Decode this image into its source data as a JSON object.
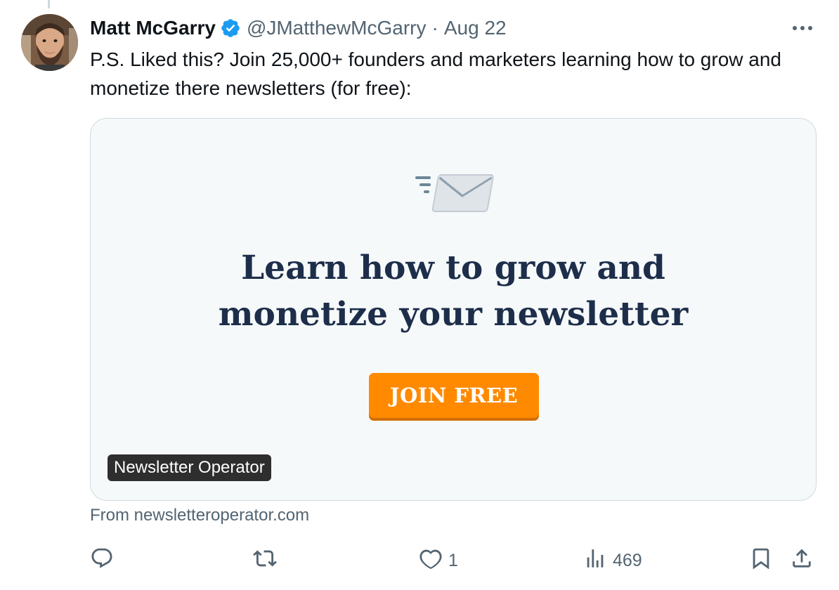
{
  "tweet": {
    "display_name": "Matt McGarry",
    "handle": "@JMatthewMcGarry",
    "separator": "·",
    "date": "Aug 22",
    "text": "P.S. Liked this? Join 25,000+ founders and marketers learning how to grow and monetize there newsletters (for free):"
  },
  "card": {
    "headline_line1": "Learn how to grow and",
    "headline_line2": "monetize your newsletter",
    "button_label": "JOIN FREE",
    "site_badge": "Newsletter Operator",
    "source": "From newsletteroperator.com"
  },
  "actions": {
    "reply_count": "",
    "retweet_count": "",
    "like_count": "1",
    "views_count": "469"
  },
  "icons": {
    "verified": "verified-badge-icon",
    "more": "more-icon",
    "mail": "envelope-icon",
    "reply": "reply-icon",
    "retweet": "retweet-icon",
    "like": "heart-icon",
    "views": "views-icon",
    "bookmark": "bookmark-icon",
    "share": "share-icon"
  },
  "colors": {
    "verified_blue": "#1d9bf0",
    "text_secondary": "#536471",
    "card_bg": "#f6f9fa",
    "headline_navy": "#1d2e4a",
    "button_orange": "#ff8a00"
  }
}
